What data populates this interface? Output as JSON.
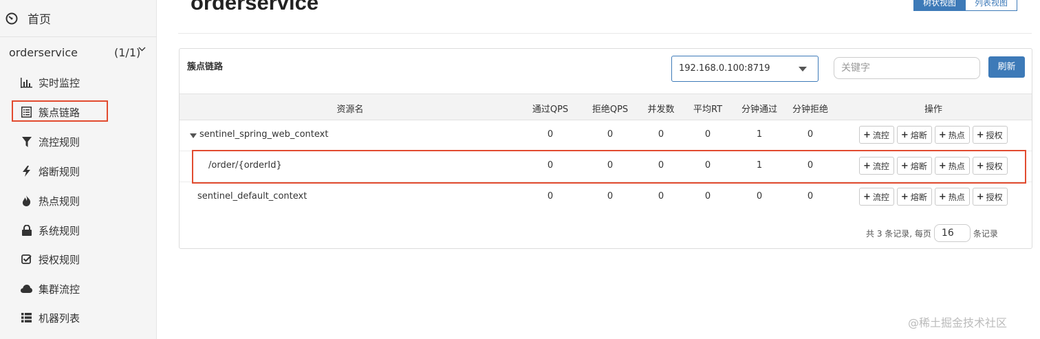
{
  "sidebar": {
    "home_label": "首页",
    "app_name": "orderservice",
    "app_count": "(1/1)",
    "items": [
      {
        "label": "实时监控",
        "icon": "bar-chart-icon"
      },
      {
        "label": "簇点链路",
        "icon": "list-alt-icon"
      },
      {
        "label": "流控规则",
        "icon": "filter-icon"
      },
      {
        "label": "熔断规则",
        "icon": "flash-icon"
      },
      {
        "label": "热点规则",
        "icon": "fire-icon"
      },
      {
        "label": "系统规则",
        "icon": "lock-icon"
      },
      {
        "label": "授权规则",
        "icon": "check-icon"
      },
      {
        "label": "集群流控",
        "icon": "cloud-icon"
      },
      {
        "label": "机器列表",
        "icon": "th-list-icon"
      }
    ],
    "selected_item": "簇点链路"
  },
  "header": {
    "title": "orderservice",
    "view_tree": "树状视图",
    "view_list": "列表视图"
  },
  "panel": {
    "title": "簇点链路",
    "machine_select": "192.168.0.100:8719",
    "search_placeholder": "关键字",
    "refresh_label": "刷新"
  },
  "table": {
    "columns": [
      "资源名",
      "通过QPS",
      "拒绝QPS",
      "并发数",
      "平均RT",
      "分钟通过",
      "分钟拒绝",
      "操作"
    ],
    "rows": [
      {
        "name": "sentinel_spring_web_context",
        "pass_qps": "0",
        "block_qps": "0",
        "concurrency": "0",
        "avg_rt": "0",
        "min_pass": "1",
        "min_block": "0",
        "expanded": true,
        "level": 0
      },
      {
        "name": "/order/{orderId}",
        "pass_qps": "0",
        "block_qps": "0",
        "concurrency": "0",
        "avg_rt": "0",
        "min_pass": "1",
        "min_block": "0",
        "level": 1
      },
      {
        "name": "sentinel_default_context",
        "pass_qps": "0",
        "block_qps": "0",
        "concurrency": "0",
        "avg_rt": "0",
        "min_pass": "0",
        "min_block": "0",
        "level": 0
      }
    ],
    "actions": [
      "流控",
      "熔断",
      "热点",
      "授权"
    ]
  },
  "pagination": {
    "prefix": "共 3 条记录, 每页",
    "page_size": "16",
    "suffix": "条记录"
  },
  "watermark": "@稀土掘金技术社区",
  "colors": {
    "primary": "#3d7ab8",
    "highlight": "#e24b2f",
    "sidebar_bg": "#f5f5f5"
  }
}
